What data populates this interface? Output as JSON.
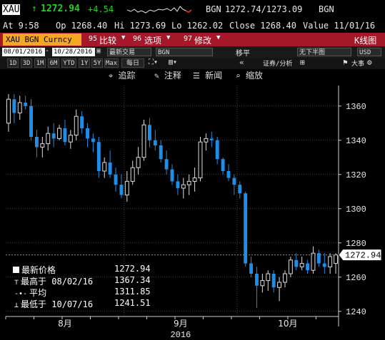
{
  "ticker": {
    "symbol": "XAU",
    "arrow": "↑",
    "last": "1272.94",
    "change": "+4.54",
    "source": "BGN",
    "bid_ask": "1272.74/1273.09",
    "source2": "BGN"
  },
  "stats": {
    "time": "At 9:58",
    "open": "Op 1268.40",
    "high": "Hi 1273.69",
    "low": "Lo 1262.02",
    "close": "Close 1268.40",
    "value": "Value 11/01/16"
  },
  "menu": {
    "security": "XAU BGN Curncy",
    "compare": "比较",
    "compare_num": "95",
    "select": "选项",
    "select_num": "96",
    "modify": "修改",
    "modify_num": "97",
    "chart_type": "K线图"
  },
  "range": {
    "start": "08/01/2016",
    "end": "10/28/2016",
    "period": "最新交易",
    "source": "BGN",
    "move": "移平",
    "range_type": "无下半图",
    "currency": "USD"
  },
  "periods": [
    "1D",
    "3D",
    "1M",
    "6M",
    "YTD",
    "1Y",
    "5Y",
    "Max"
  ],
  "freq": "每日",
  "right_btns": {
    "sec_analysis": "证券/分析",
    "big": "大事"
  },
  "tools": {
    "track": "追踪",
    "annotate": "注释",
    "news": "新闻",
    "zoom": "缩放"
  },
  "legend": {
    "last_label": "最新价格",
    "last_val": "1272.94",
    "high_label": "最高于 08/02/16",
    "high_val": "1367.34",
    "avg_label": "平均",
    "avg_val": "1311.85",
    "low_label": "最低于 10/07/16",
    "low_val": "1241.51"
  },
  "price_tag": "1272.94",
  "colors": {
    "up": "#ffffff",
    "down": "#1e8ee8",
    "accent": "#f5a623",
    "menu": "#a5182a"
  },
  "chart_data": {
    "type": "candlestick",
    "yticks": [
      1240,
      1260,
      1280,
      1300,
      1320,
      1340,
      1360
    ],
    "ylim": [
      1237,
      1372
    ],
    "xlabels": [
      "8月",
      "9月",
      "10月"
    ],
    "year": "2016",
    "ohlc": [
      [
        1350,
        1367,
        1345,
        1364
      ],
      [
        1364,
        1367,
        1350,
        1356
      ],
      [
        1356,
        1366,
        1352,
        1362
      ],
      [
        1362,
        1366,
        1358,
        1360
      ],
      [
        1360,
        1364,
        1340,
        1342
      ],
      [
        1342,
        1346,
        1330,
        1336
      ],
      [
        1336,
        1342,
        1330,
        1338
      ],
      [
        1338,
        1348,
        1334,
        1344
      ],
      [
        1344,
        1350,
        1336,
        1341
      ],
      [
        1341,
        1349,
        1340,
        1347
      ],
      [
        1347,
        1352,
        1337,
        1339
      ],
      [
        1339,
        1346,
        1335,
        1343
      ],
      [
        1343,
        1358,
        1340,
        1354
      ],
      [
        1354,
        1357,
        1344,
        1347
      ],
      [
        1347,
        1350,
        1336,
        1341
      ],
      [
        1341,
        1344,
        1333,
        1339
      ],
      [
        1339,
        1342,
        1318,
        1322
      ],
      [
        1322,
        1330,
        1318,
        1327
      ],
      [
        1327,
        1334,
        1318,
        1320
      ],
      [
        1320,
        1324,
        1310,
        1314
      ],
      [
        1314,
        1320,
        1306,
        1308
      ],
      [
        1308,
        1322,
        1304,
        1316
      ],
      [
        1316,
        1328,
        1314,
        1324
      ],
      [
        1324,
        1336,
        1320,
        1330
      ],
      [
        1330,
        1352,
        1328,
        1349
      ],
      [
        1349,
        1353,
        1336,
        1340
      ],
      [
        1340,
        1346,
        1334,
        1337
      ],
      [
        1337,
        1340,
        1327,
        1329
      ],
      [
        1329,
        1334,
        1320,
        1323
      ],
      [
        1323,
        1326,
        1314,
        1316
      ],
      [
        1316,
        1320,
        1308,
        1312
      ],
      [
        1312,
        1318,
        1306,
        1314
      ],
      [
        1314,
        1320,
        1308,
        1316
      ],
      [
        1316,
        1324,
        1310,
        1318
      ],
      [
        1318,
        1342,
        1316,
        1339
      ],
      [
        1339,
        1344,
        1334,
        1341
      ],
      [
        1341,
        1345,
        1336,
        1340
      ],
      [
        1340,
        1342,
        1326,
        1329
      ],
      [
        1329,
        1330,
        1320,
        1322
      ],
      [
        1322,
        1326,
        1316,
        1318
      ],
      [
        1318,
        1320,
        1308,
        1314
      ],
      [
        1314,
        1316,
        1306,
        1309
      ],
      [
        1309,
        1310,
        1266,
        1268
      ],
      [
        1268,
        1272,
        1260,
        1262
      ],
      [
        1262,
        1266,
        1242,
        1255
      ],
      [
        1255,
        1262,
        1251,
        1258
      ],
      [
        1258,
        1264,
        1252,
        1262
      ],
      [
        1262,
        1264,
        1251,
        1254
      ],
      [
        1254,
        1260,
        1246,
        1257
      ],
      [
        1257,
        1264,
        1254,
        1262
      ],
      [
        1262,
        1272,
        1260,
        1270
      ],
      [
        1270,
        1274,
        1264,
        1266
      ],
      [
        1266,
        1272,
        1264,
        1268
      ],
      [
        1268,
        1270,
        1262,
        1264
      ],
      [
        1264,
        1278,
        1262,
        1274
      ],
      [
        1274,
        1276,
        1266,
        1268
      ],
      [
        1268,
        1274,
        1262,
        1266
      ],
      [
        1266,
        1274,
        1262,
        1272
      ],
      [
        1268,
        1274,
        1262,
        1273
      ]
    ]
  }
}
